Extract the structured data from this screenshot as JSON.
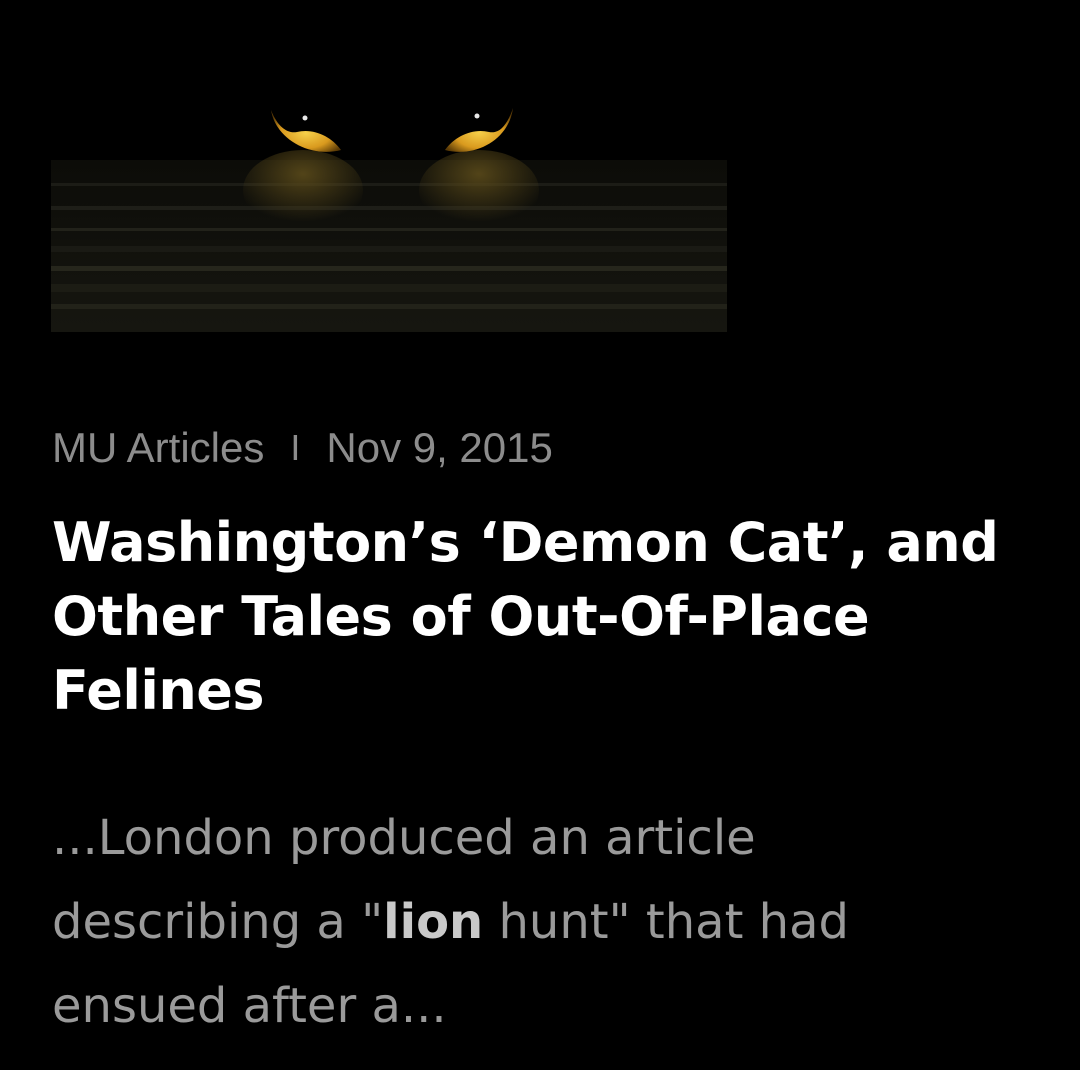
{
  "article": {
    "image_alt": "Glowing cat eyes reflected on dark water",
    "category": "MU Articles",
    "separator": "I",
    "date": "Nov 9, 2015",
    "title": "Washington’s ‘Demon Cat’, and Other Tales of Out-Of-Place Felines",
    "excerpt": {
      "before": "...London produced an article describing a \"",
      "highlight": "lion",
      "after": " hunt\" that had ensued after a..."
    }
  },
  "colors": {
    "background": "#000000",
    "title": "#ffffff",
    "meta": "#8c8c8c",
    "excerpt": "#9a9a9a",
    "eye_glow": "#e0b02a"
  }
}
